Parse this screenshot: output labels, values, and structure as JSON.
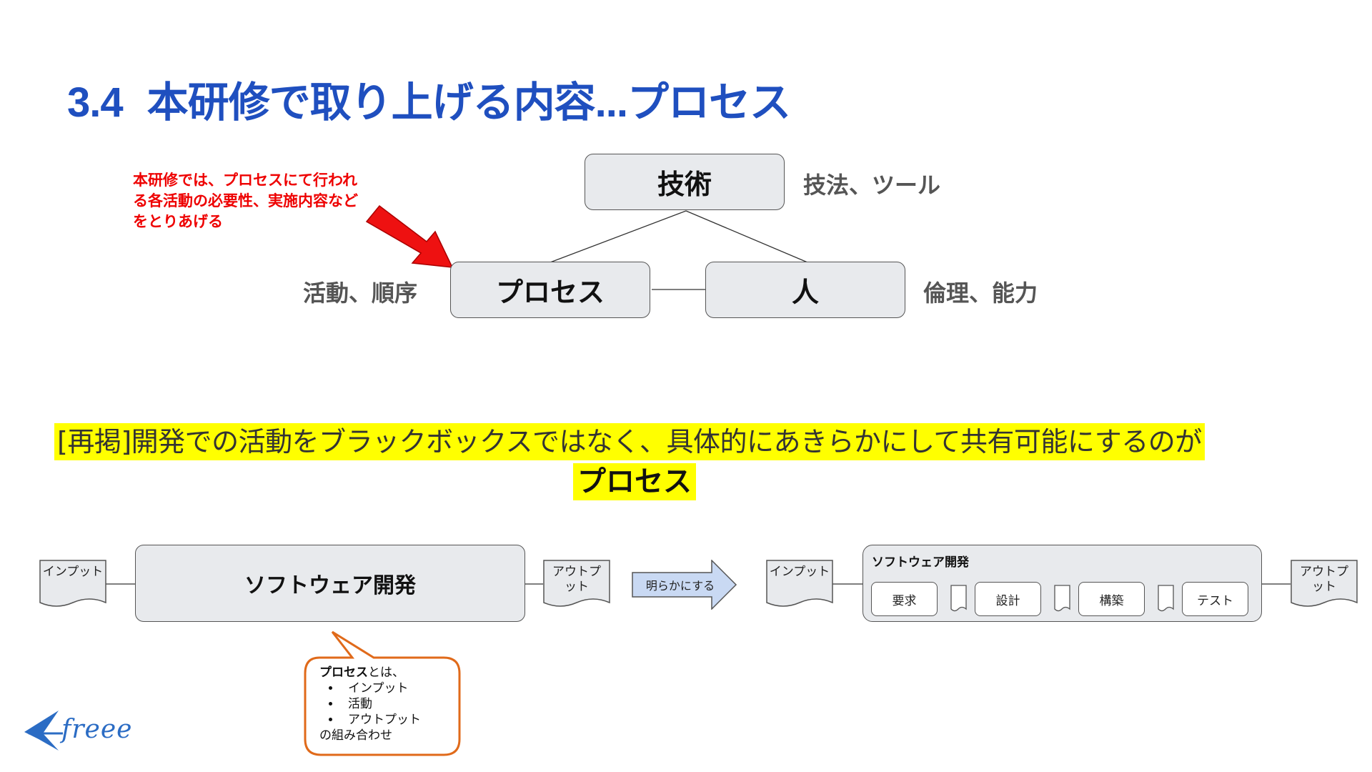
{
  "title": {
    "number": "3.4",
    "text": "本研修で取り上げる内容...プロセス"
  },
  "triangle": {
    "top_box": "技術",
    "top_label": "技法、ツール",
    "left_box": "プロセス",
    "left_label": "活動、順序",
    "right_box": "人",
    "right_label": "倫理、能力"
  },
  "red_note": "本研修では、プロセスにて行われる各活動の必要性、実施内容などをとりあげる",
  "highlight": {
    "line": "[再掲]開発での活動をブラックボックスではなく、具体的にあきらかにして共有可能にするのが",
    "word": "プロセス"
  },
  "flow_left": {
    "input_label": "インプット",
    "main_box": "ソフトウェア開発",
    "output_label": "アウトプット"
  },
  "arrow_label": "明らかにする",
  "flow_right": {
    "input_label": "インプット",
    "container_title": "ソフトウェア開発",
    "steps": [
      "要求",
      "設計",
      "構築",
      "テスト"
    ],
    "output_label": "アウトプット"
  },
  "callout": {
    "lead_bold": "プロセス",
    "lead_rest": "とは、",
    "items": [
      "インプット",
      "活動",
      "アウトプット"
    ],
    "tail": "の組み合わせ"
  },
  "logo": "freee",
  "colors": {
    "title": "#1f4fbf",
    "note": "#ee0000",
    "highlight": "#ffff00",
    "callout_border": "#e06a1a",
    "arrow_fill": "#c9d9f3"
  }
}
